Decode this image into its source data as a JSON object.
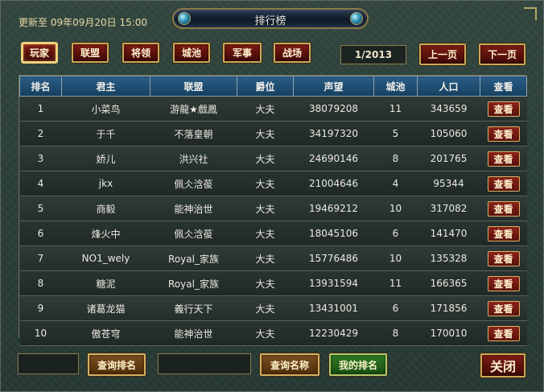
{
  "header": {
    "update_text": "更新至 09年09月20日 15:00",
    "title": "排行榜"
  },
  "tabs": [
    {
      "label": "玩家",
      "active": true
    },
    {
      "label": "联盟",
      "active": false
    },
    {
      "label": "将领",
      "active": false
    },
    {
      "label": "城池",
      "active": false
    },
    {
      "label": "军事",
      "active": false
    },
    {
      "label": "战场",
      "active": false
    }
  ],
  "pager": {
    "page": "1/2013",
    "prev_label": "上一页",
    "next_label": "下一页"
  },
  "table": {
    "columns": [
      "排名",
      "君主",
      "联盟",
      "爵位",
      "声望",
      "城池",
      "人口",
      "查看"
    ],
    "view_label": "查看",
    "rows": [
      {
        "rank": "1",
        "lord": "小菜鸟",
        "alliance": "游龍★戲鳳",
        "title": "大夫",
        "prestige": "38079208",
        "cities": "11",
        "population": "343659"
      },
      {
        "rank": "2",
        "lord": "于千",
        "alliance": "不落皇朝",
        "title": "大夫",
        "prestige": "34197320",
        "cities": "5",
        "population": "105060"
      },
      {
        "rank": "3",
        "lord": "娇儿",
        "alliance": "洪兴社",
        "title": "大夫",
        "prestige": "24690146",
        "cities": "8",
        "population": "201765"
      },
      {
        "rank": "4",
        "lord": "jkx",
        "alliance": "佩仌浛葰",
        "title": "大夫",
        "prestige": "21004646",
        "cities": "4",
        "population": "95344"
      },
      {
        "rank": "5",
        "lord": "商毅",
        "alliance": "能神治世",
        "title": "大夫",
        "prestige": "19469212",
        "cities": "10",
        "population": "317082"
      },
      {
        "rank": "6",
        "lord": "烽火中",
        "alliance": "佩仌浛葰",
        "title": "大夫",
        "prestige": "18045106",
        "cities": "6",
        "population": "141470"
      },
      {
        "rank": "7",
        "lord": "NO1_wely",
        "alliance": "Royal_家族",
        "title": "大夫",
        "prestige": "15776486",
        "cities": "10",
        "population": "135328"
      },
      {
        "rank": "8",
        "lord": "糖泥",
        "alliance": "Royal_家族",
        "title": "大夫",
        "prestige": "13931594",
        "cities": "11",
        "population": "166365"
      },
      {
        "rank": "9",
        "lord": "诸葛龙猫",
        "alliance": "義行天下",
        "title": "大夫",
        "prestige": "13431001",
        "cities": "6",
        "population": "171856"
      },
      {
        "rank": "10",
        "lord": "傲苍穹",
        "alliance": "能神治世",
        "title": "大夫",
        "prestige": "12230429",
        "cities": "8",
        "population": "170010"
      }
    ]
  },
  "footer": {
    "rank_query_value": "",
    "rank_query_label": "查询排名",
    "name_query_value": "",
    "name_query_label": "查询名称",
    "my_rank_label": "我的排名",
    "close_label": "关闭"
  }
}
